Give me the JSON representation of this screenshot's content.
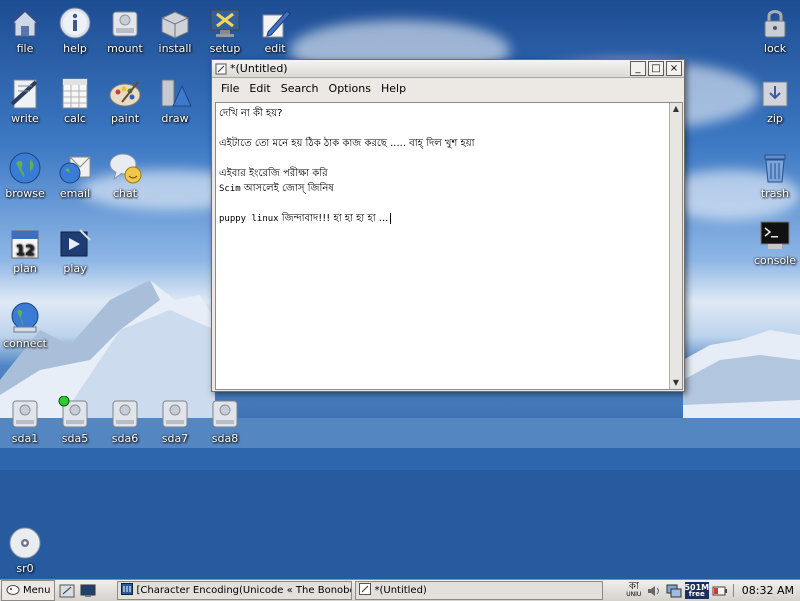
{
  "desktop": {
    "icons_left": [
      {
        "id": "file",
        "label": "file"
      },
      {
        "id": "help",
        "label": "help"
      },
      {
        "id": "mount",
        "label": "mount"
      },
      {
        "id": "install",
        "label": "install"
      },
      {
        "id": "setup",
        "label": "setup"
      },
      {
        "id": "edit",
        "label": "edit"
      },
      {
        "id": "write",
        "label": "write"
      },
      {
        "id": "calc",
        "label": "calc"
      },
      {
        "id": "paint",
        "label": "paint"
      },
      {
        "id": "draw",
        "label": "draw"
      },
      {
        "id": "browse",
        "label": "browse"
      },
      {
        "id": "email",
        "label": "email"
      },
      {
        "id": "chat",
        "label": "chat"
      },
      {
        "id": "plan",
        "label": "plan"
      },
      {
        "id": "play",
        "label": "play"
      },
      {
        "id": "connect",
        "label": "connect"
      }
    ],
    "icons_right": [
      {
        "id": "lock",
        "label": "lock"
      },
      {
        "id": "zip",
        "label": "zip"
      },
      {
        "id": "trash",
        "label": "trash"
      },
      {
        "id": "console",
        "label": "console"
      }
    ],
    "drives": [
      {
        "label": "sda1",
        "mounted": false
      },
      {
        "label": "sda5",
        "mounted": true
      },
      {
        "label": "sda6",
        "mounted": false
      },
      {
        "label": "sda7",
        "mounted": false
      },
      {
        "label": "sda8",
        "mounted": false
      }
    ],
    "cd": {
      "label": "sr0"
    },
    "calendar_icon": {
      "day": "12"
    }
  },
  "window": {
    "title": "*(Untitled)",
    "buttons": {
      "minimize": "_",
      "maximize": "□",
      "close": "×"
    },
    "menu": [
      "File",
      "Edit",
      "Search",
      "Options",
      "Help"
    ],
    "lines": [
      {
        "text": "দেখি না কী হয়?"
      },
      {
        "text": ""
      },
      {
        "text": "এইটাতে তো মনে হয় ঠিক ঠাক কাজ করছে ..... বাহ্ দিল খুশ হয়া"
      },
      {
        "text": ""
      },
      {
        "text": "এইবার ইংরেজি পরীক্ষা করি"
      },
      {
        "latin": "Scim",
        "text": " আসলেই জোস্ জিনিষ"
      },
      {
        "text": ""
      },
      {
        "latin": "puppy linux",
        "text": " জিন্দাবাদ!!! হা হা হা হা ..."
      }
    ]
  },
  "taskbar": {
    "menu_label": "Menu",
    "tasks": [
      {
        "label": "[Character Encoding(Unicode « The Bonobo Jo"
      },
      {
        "label": "*(Untitled)"
      }
    ],
    "tray": {
      "keyboard": "কা",
      "keyboard_sub": "UNIU",
      "memory": "501M",
      "memory_sub": "free"
    },
    "clock": "08:32 AM"
  }
}
